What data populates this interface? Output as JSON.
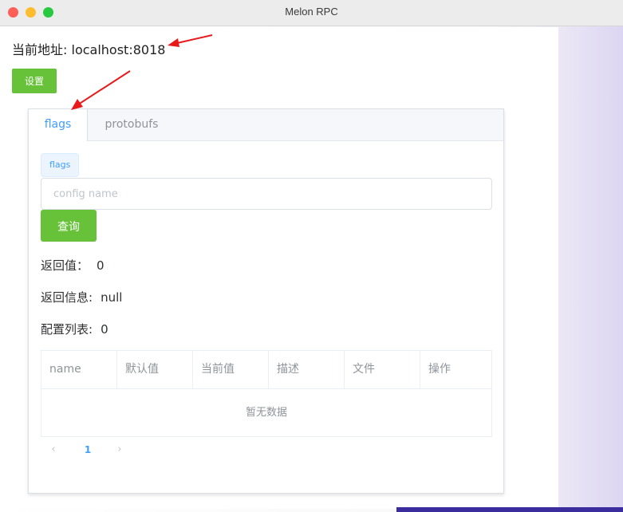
{
  "window": {
    "title": "Melon RPC"
  },
  "address": {
    "label": "当前地址:",
    "value": "localhost:8018"
  },
  "settings_button": "设置",
  "tabs": [
    {
      "label": "flags",
      "active": true
    },
    {
      "label": "protobufs",
      "active": false
    }
  ],
  "form": {
    "tag": "flags",
    "input_placeholder": "config name",
    "input_value": "",
    "query_button": "查询"
  },
  "results": {
    "return_value": {
      "label": "返回值：",
      "value": "0"
    },
    "return_message": {
      "label": "返回信息:",
      "value": "null"
    },
    "config_list": {
      "label": "配置列表:",
      "value": "0"
    }
  },
  "table": {
    "columns": [
      "name",
      "默认值",
      "当前值",
      "描述",
      "文件",
      "操作"
    ],
    "empty_text": "暂无数据"
  },
  "pagination": {
    "prev": "‹",
    "current": "1",
    "next": "›"
  },
  "colors": {
    "accent": "#409eff",
    "success": "#67c23a",
    "annotation": "#e8191a"
  },
  "icons": {
    "prev": "chevron-left-icon",
    "next": "chevron-right-icon"
  }
}
